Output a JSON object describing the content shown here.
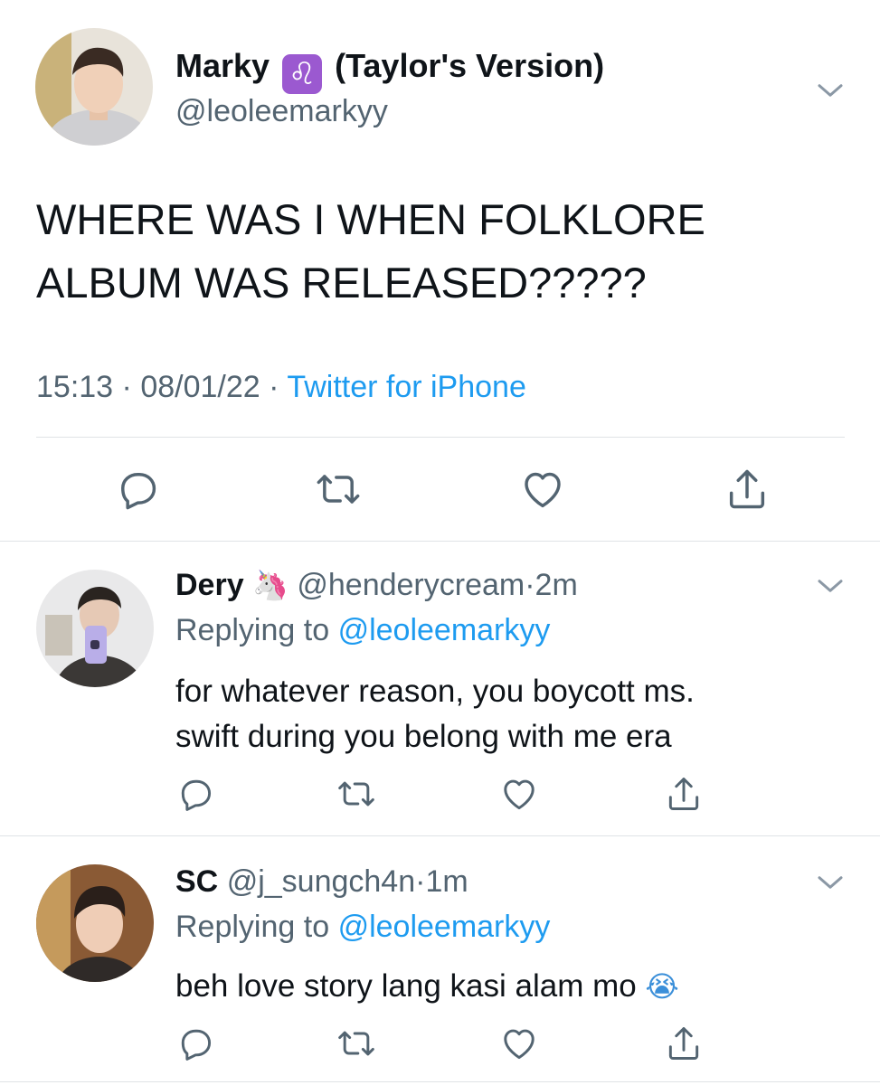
{
  "main_tweet": {
    "name_before": "Marky",
    "name_symbol": "♌",
    "name_after": "(Taylor's Version)",
    "handle": "@leoleemarkyy",
    "text_line1": "WHERE WAS I WHEN FOLKLORE",
    "text_line2": "ALBUM WAS RELEASED?????",
    "time": "15:13",
    "date": "08/01/22",
    "separator": "·",
    "source": "Twitter for iPhone"
  },
  "replies": [
    {
      "name": "Dery",
      "emoji": "🦄",
      "handle": "@henderycream",
      "age": "2m",
      "replying_prefix": "Replying to",
      "replying_handle": "@leoleemarkyy",
      "text_line1": "for whatever reason, you boycott ms.",
      "text_line2": "swift during you belong with me era"
    },
    {
      "name": "SC",
      "handle": "@j_sungch4n",
      "age": "1m",
      "replying_prefix": "Replying to",
      "replying_handle": "@leoleemarkyy",
      "text_line1": "beh love story lang kasi alam mo",
      "emoji": "😭"
    }
  ],
  "icons": {
    "chevron": "chevron-down-icon",
    "reply": "reply-icon",
    "retweet": "retweet-icon",
    "like": "like-icon",
    "share": "share-icon"
  },
  "colors": {
    "text": "#0f1419",
    "secondary": "#536471",
    "link": "#1d9bf0",
    "divider": "#dfe3e6",
    "leo_badge": "#9b59d0"
  }
}
